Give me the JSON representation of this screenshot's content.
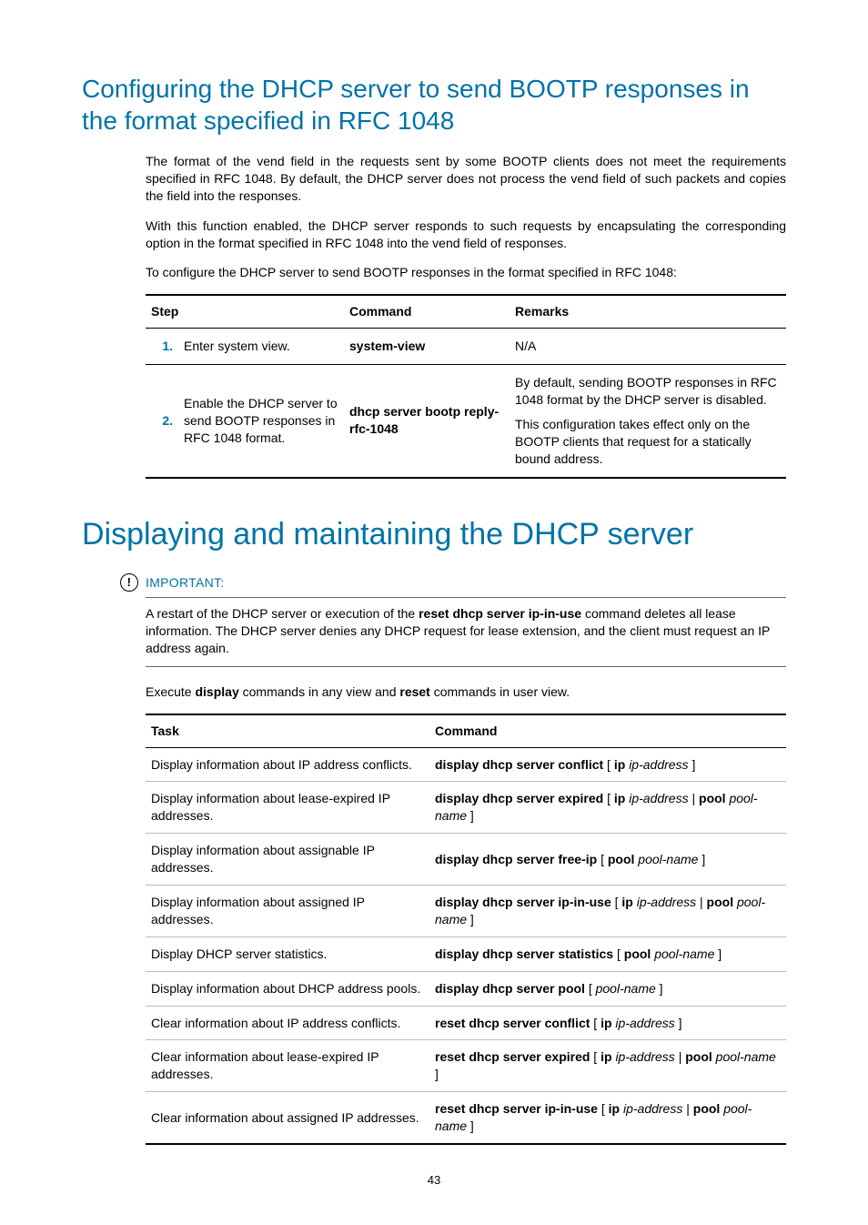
{
  "section1": {
    "heading": "Configuring the DHCP server to send BOOTP responses in the format specified in RFC 1048",
    "para1": "The format of the vend field in the requests sent by some BOOTP clients does not meet the requirements specified in RFC 1048. By default, the DHCP server does not process the vend field of such packets and copies the field into the responses.",
    "para2": "With this function enabled, the DHCP server responds to such requests by encapsulating the corresponding option in the format specified in RFC 1048 into the vend field of responses.",
    "para3": "To configure the DHCP server to send BOOTP responses in the format specified in RFC 1048:",
    "table": {
      "headers": {
        "step": "Step",
        "command": "Command",
        "remarks": "Remarks"
      },
      "rows": [
        {
          "num": "1.",
          "desc": "Enter system view.",
          "command_bold": "system-view",
          "remarks_plain": "N/A"
        },
        {
          "num": "2.",
          "desc": "Enable the DHCP server to send BOOTP responses in RFC 1048 format.",
          "command_bold": "dhcp server bootp reply-rfc-1048",
          "remarks_p1": "By default, sending BOOTP responses in RFC 1048 format by the DHCP server is disabled.",
          "remarks_p2": "This configuration takes effect only on the BOOTP clients that request for a statically bound address."
        }
      ]
    }
  },
  "section2": {
    "heading": "Displaying and maintaining the DHCP server",
    "important_label": "IMPORTANT:",
    "important": {
      "t1": "A restart of the DHCP server or execution of the ",
      "b1": "reset dhcp server ip-in-use",
      "t2": " command deletes all lease information. The DHCP server denies any DHCP request for lease extension, and the client must request an IP address again."
    },
    "exec": {
      "t1": "Execute ",
      "b1": "display",
      "t2": " commands in any view and ",
      "b2": "reset",
      "t3": " commands in user view."
    },
    "table": {
      "headers": {
        "task": "Task",
        "command": "Command"
      },
      "rows": [
        {
          "task": "Display information about IP address conflicts.",
          "cmd": [
            {
              "b": "display dhcp server conflict"
            },
            {
              "t": " [ "
            },
            {
              "b": "ip"
            },
            {
              "t": " "
            },
            {
              "i": "ip-address"
            },
            {
              "t": " ]"
            }
          ]
        },
        {
          "task": "Display information about lease-expired IP addresses.",
          "cmd": [
            {
              "b": "display dhcp server expired"
            },
            {
              "t": " [ "
            },
            {
              "b": "ip"
            },
            {
              "t": " "
            },
            {
              "i": "ip-address"
            },
            {
              "t": " | "
            },
            {
              "b": "pool"
            },
            {
              "t": " "
            },
            {
              "i": "pool-name"
            },
            {
              "t": " ]"
            }
          ]
        },
        {
          "task": "Display information about assignable IP addresses.",
          "cmd": [
            {
              "b": "display dhcp server free-ip"
            },
            {
              "t": " [ "
            },
            {
              "b": "pool"
            },
            {
              "t": " "
            },
            {
              "i": "pool-name"
            },
            {
              "t": " ]"
            }
          ]
        },
        {
          "task": "Display information about assigned IP addresses.",
          "cmd": [
            {
              "b": "display dhcp server ip-in-use"
            },
            {
              "t": " [ "
            },
            {
              "b": "ip"
            },
            {
              "t": " "
            },
            {
              "i": "ip-address"
            },
            {
              "t": " | "
            },
            {
              "b": "pool"
            },
            {
              "t": " "
            },
            {
              "i": "pool-name"
            },
            {
              "t": " ]"
            }
          ]
        },
        {
          "task": "Display DHCP server statistics.",
          "cmd": [
            {
              "b": "display dhcp server statistics"
            },
            {
              "t": " [ "
            },
            {
              "b": "pool"
            },
            {
              "t": " "
            },
            {
              "i": "pool-name"
            },
            {
              "t": " ]"
            }
          ]
        },
        {
          "task": "Display information about DHCP address pools.",
          "cmd": [
            {
              "b": "display dhcp server pool"
            },
            {
              "t": " [ "
            },
            {
              "i": "pool-name"
            },
            {
              "t": " ]"
            }
          ]
        },
        {
          "task": "Clear information about IP address conflicts.",
          "cmd": [
            {
              "b": "reset dhcp server conflict"
            },
            {
              "t": " [ "
            },
            {
              "b": "ip"
            },
            {
              "t": " "
            },
            {
              "i": "ip-address"
            },
            {
              "t": " ]"
            }
          ]
        },
        {
          "task": "Clear information about lease-expired IP addresses.",
          "cmd": [
            {
              "b": "reset dhcp server expired"
            },
            {
              "t": " [ "
            },
            {
              "b": "ip"
            },
            {
              "t": " "
            },
            {
              "i": "ip-address"
            },
            {
              "t": " | "
            },
            {
              "b": "pool"
            },
            {
              "t": " "
            },
            {
              "i": "pool-name"
            },
            {
              "t": " ]"
            }
          ]
        },
        {
          "task": "Clear information about assigned IP addresses.",
          "cmd": [
            {
              "b": "reset dhcp server ip-in-use"
            },
            {
              "t": " [ "
            },
            {
              "b": "ip"
            },
            {
              "t": " "
            },
            {
              "i": "ip-address"
            },
            {
              "t": " | "
            },
            {
              "b": "pool"
            },
            {
              "t": " "
            },
            {
              "i": "pool-name"
            },
            {
              "t": " ]"
            }
          ]
        }
      ]
    }
  },
  "page_number": "43"
}
